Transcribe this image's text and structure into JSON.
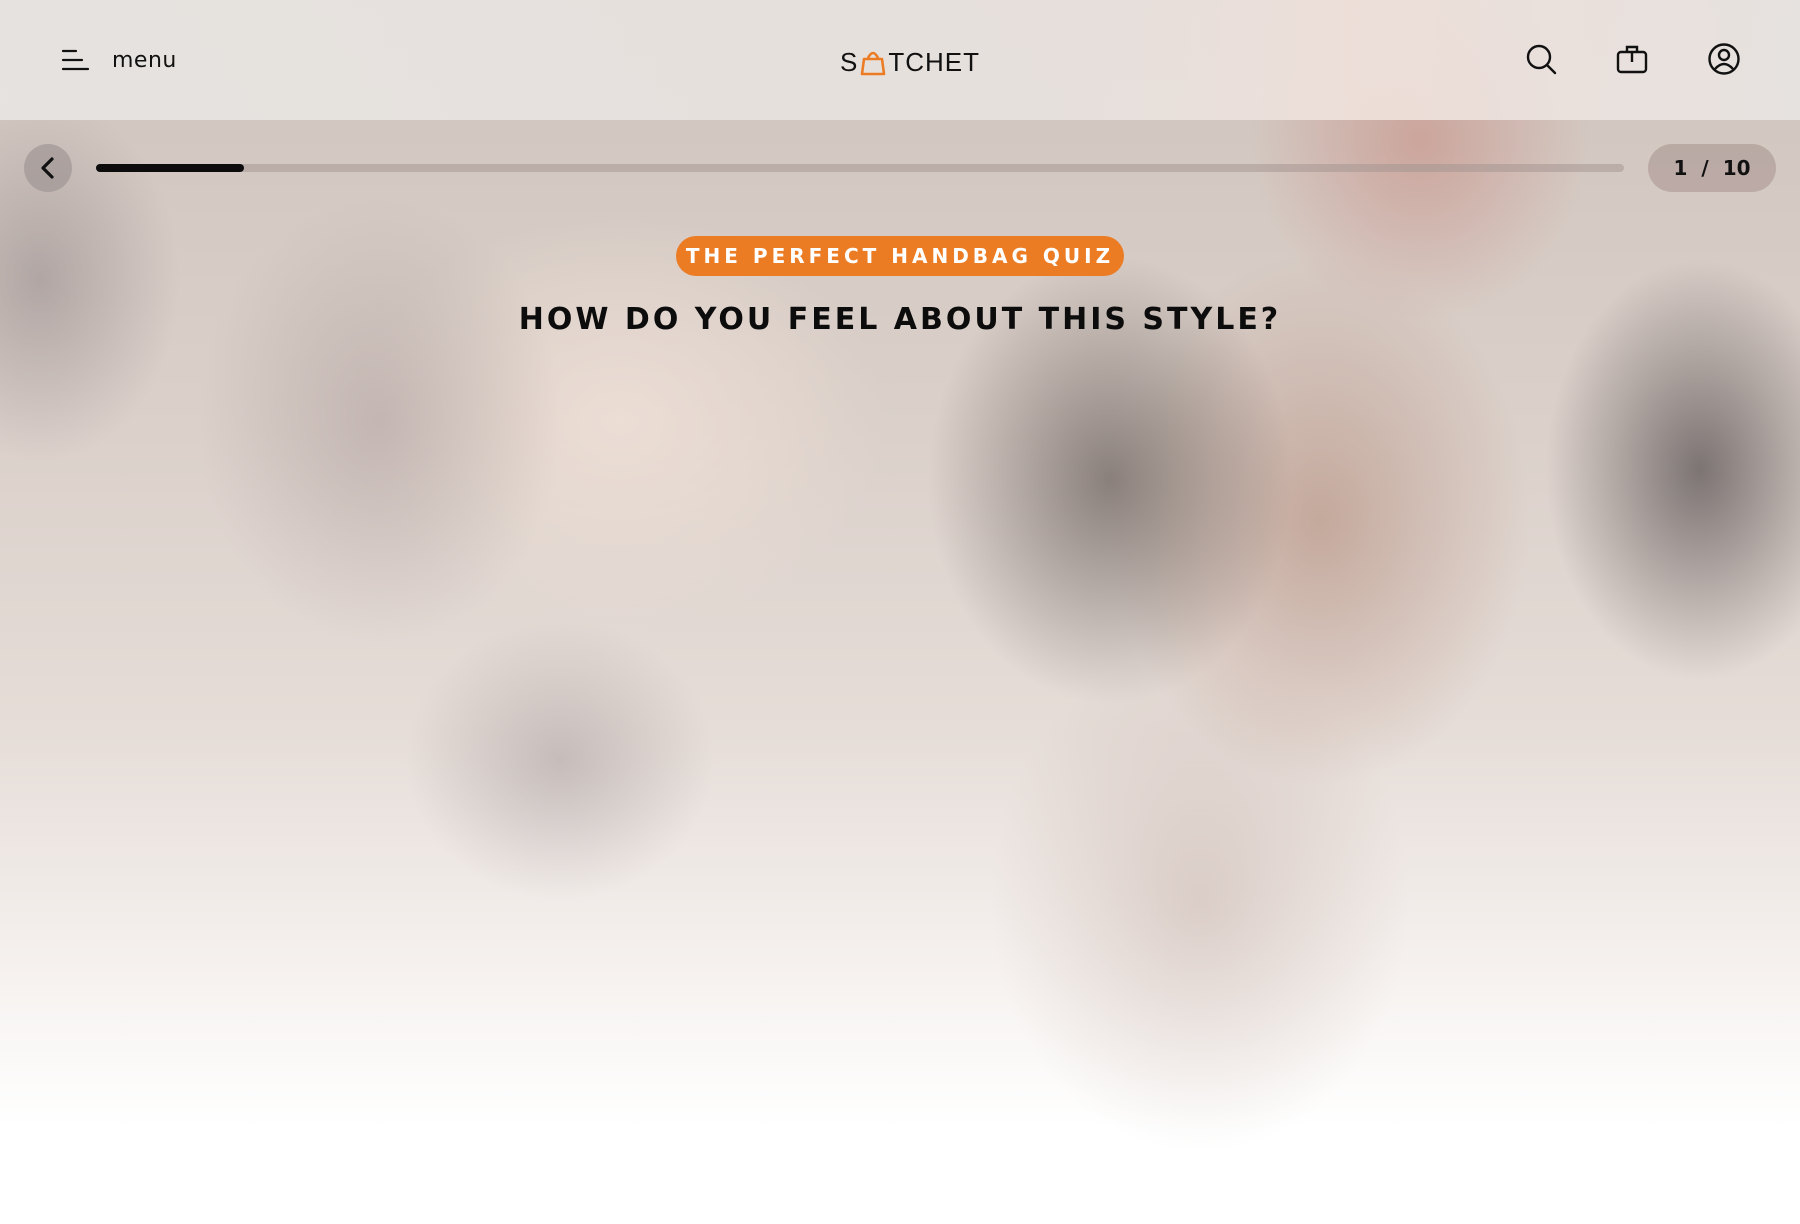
{
  "header": {
    "menu_label": "menu",
    "logo": {
      "prefix": "S",
      "suffix": "TCHET",
      "accent_color": "#ec7c24"
    },
    "icons": [
      "menu-icon",
      "search-icon",
      "shopping-bag-icon",
      "account-icon"
    ]
  },
  "quiz": {
    "back_icon": "chevron-left-icon",
    "progress": {
      "current": 1,
      "total": 10,
      "separator": "/"
    },
    "badge_label": "THE PERFECT HANDBAG QUIZ",
    "question": "HOW DO YOU FEEL ABOUT THIS STYLE?"
  },
  "colors": {
    "accent": "#ec7c24",
    "text": "#111111",
    "progress_fill": "#0c0c0c"
  }
}
